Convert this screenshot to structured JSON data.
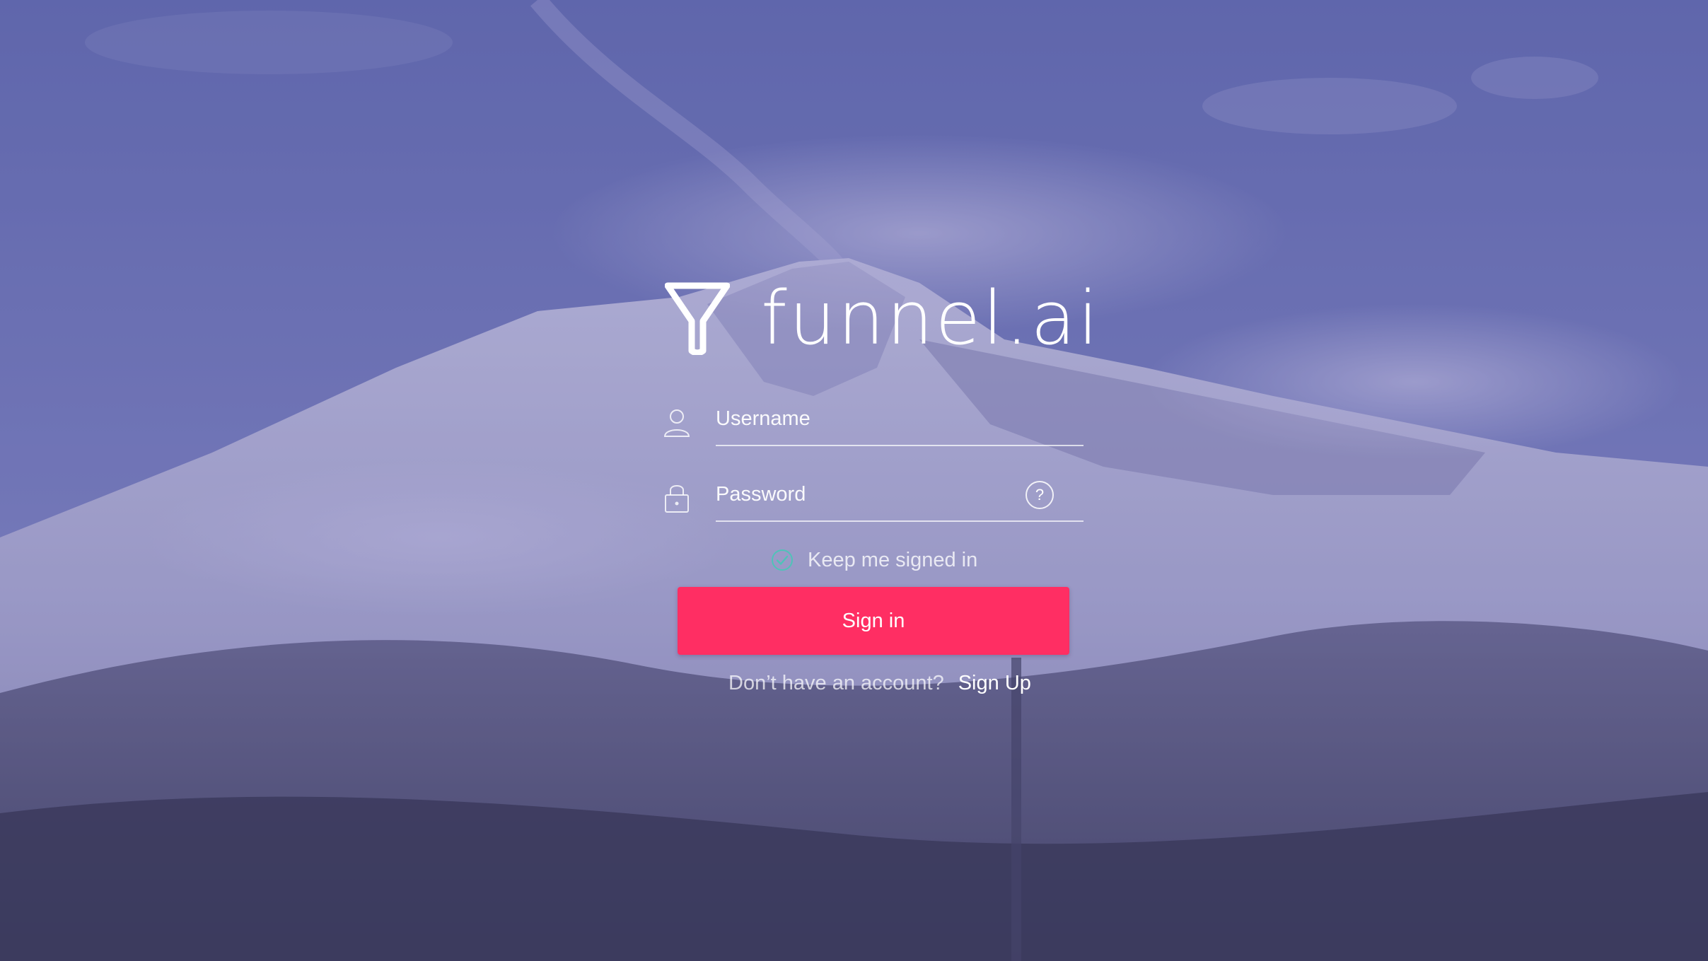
{
  "brand": {
    "name": "funnel.ai",
    "logo_icon": "funnel-icon"
  },
  "form": {
    "username": {
      "placeholder": "Username",
      "value": "",
      "icon": "user-icon"
    },
    "password": {
      "placeholder": "Password",
      "value": "",
      "icon": "lock-icon",
      "help_label": "?",
      "help_icon": "help-circle-icon"
    },
    "keep_signed_in": {
      "label": "Keep me signed in",
      "checked": true,
      "icon": "check-circle-icon"
    },
    "submit_label": "Sign in"
  },
  "signup": {
    "prompt": "Don’t have an account?",
    "link_label": "Sign Up"
  },
  "colors": {
    "accent": "#ff2e63",
    "overlay": "#6064aa",
    "text": "#ffffff",
    "check": "#4fc3b8"
  }
}
